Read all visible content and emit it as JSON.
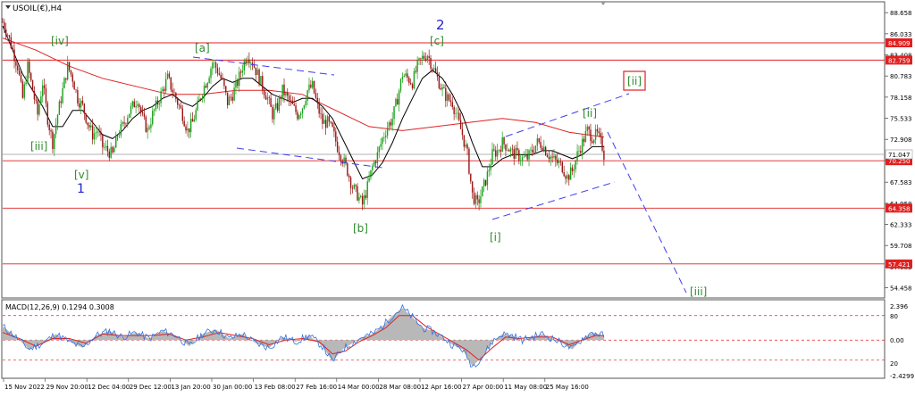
{
  "header": {
    "symbol_label": "USOIL(€),H4",
    "macd_label": "MACD(12,26,9) 0.1294 0.3008"
  },
  "colors": {
    "bull": "#1aa01a",
    "bear": "#9a1414",
    "ma_fast": "#000000",
    "ma_slow": "#e02020",
    "level_line": "#e02020",
    "channel": "#3d3df0",
    "wave_green": "#2e8b2e",
    "wave_blue": "#2222cc",
    "macd_signal": "#e02020",
    "macd_main": "#3070e0",
    "macd_hist": "#b8b8b8"
  },
  "price_axis": {
    "min": 53.3,
    "max": 89.9,
    "ticks": [
      "88.658",
      "86.033",
      "83.408",
      "80.783",
      "78.158",
      "75.533",
      "72.908",
      "70.283",
      "67.583",
      "64.958",
      "62.333",
      "59.708",
      "57.083",
      "54.458"
    ]
  },
  "levels": [
    {
      "value": 84.909,
      "label": "84.909"
    },
    {
      "value": 82.759,
      "label": "82.759"
    },
    {
      "value": 70.25,
      "label": "70.250"
    },
    {
      "value": 64.358,
      "label": "64.358"
    },
    {
      "value": 57.421,
      "label": "57.421"
    }
  ],
  "current_price": {
    "value": 71.047,
    "label": "71.047"
  },
  "time_axis": [
    "15 Nov 2022",
    "29 Nov 20:00",
    "12 Dec 04:00",
    "29 Dec 12:00",
    "13 Jan 20:00",
    "30 Jan 00:00",
    "13 Feb 08:00",
    "27 Feb 16:00",
    "14 Mar 00:00",
    "28 Mar 08:00",
    "12 Apr 16:00",
    "27 Apr 00:00",
    "11 May 08:00",
    "25 May 16:00"
  ],
  "wave_labels": [
    "[iv]",
    "[iii]",
    "[v]",
    "1",
    "[a]",
    "[b]",
    "2",
    "[c]",
    "[i]",
    "[ii]",
    "[iii]",
    "[ii]"
  ],
  "macd_axis": {
    "ticks": [
      "2.396",
      "80",
      "0.00",
      "20",
      "-2.4299"
    ]
  },
  "price_path": [
    [
      0,
      87.5
    ],
    [
      3,
      86
    ],
    [
      6,
      84
    ],
    [
      9,
      82
    ],
    [
      12,
      78
    ],
    [
      15,
      82
    ],
    [
      18,
      79
    ],
    [
      21,
      76
    ],
    [
      24,
      80
    ],
    [
      27,
      75.5
    ],
    [
      30,
      72.5
    ],
    [
      33,
      76
    ],
    [
      36,
      79
    ],
    [
      39,
      82
    ],
    [
      42,
      80.5
    ],
    [
      45,
      78
    ],
    [
      48,
      77
    ],
    [
      51,
      75
    ],
    [
      54,
      73.5
    ],
    [
      57,
      74
    ],
    [
      60,
      72
    ],
    [
      63,
      71.5
    ],
    [
      66,
      71
    ],
    [
      69,
      73.5
    ],
    [
      72,
      74.5
    ],
    [
      75,
      76
    ],
    [
      78,
      77
    ],
    [
      81,
      78
    ],
    [
      84,
      75.5
    ],
    [
      87,
      74
    ],
    [
      90,
      76
    ],
    [
      93,
      77.5
    ],
    [
      96,
      79
    ],
    [
      99,
      80.5
    ],
    [
      102,
      79
    ],
    [
      105,
      77.5
    ],
    [
      108,
      76
    ],
    [
      111,
      74
    ],
    [
      114,
      75
    ],
    [
      117,
      77
    ],
    [
      120,
      79
    ],
    [
      123,
      80.5
    ],
    [
      126,
      82.5
    ],
    [
      129,
      81.5
    ],
    [
      132,
      80
    ],
    [
      135,
      77.5
    ],
    [
      138,
      78.5
    ],
    [
      141,
      80
    ],
    [
      144,
      82
    ],
    [
      147,
      83.5
    ],
    [
      150,
      82.5
    ],
    [
      153,
      81
    ],
    [
      156,
      79.5
    ],
    [
      159,
      78
    ],
    [
      162,
      76
    ],
    [
      165,
      77
    ],
    [
      168,
      79
    ],
    [
      171,
      78
    ],
    [
      174,
      77
    ],
    [
      177,
      76
    ],
    [
      180,
      77
    ],
    [
      183,
      79
    ],
    [
      186,
      79.5
    ],
    [
      189,
      77
    ],
    [
      192,
      75
    ],
    [
      195,
      75
    ],
    [
      198,
      74
    ],
    [
      201,
      72
    ],
    [
      204,
      70.5
    ],
    [
      207,
      69
    ],
    [
      210,
      67
    ],
    [
      213,
      66
    ],
    [
      216,
      64.8
    ],
    [
      219,
      67
    ],
    [
      222,
      69.5
    ],
    [
      225,
      71
    ],
    [
      228,
      73
    ],
    [
      231,
      74.5
    ],
    [
      234,
      75.5
    ],
    [
      237,
      78
    ],
    [
      240,
      81
    ],
    [
      243,
      80.5
    ],
    [
      246,
      80
    ],
    [
      249,
      82
    ],
    [
      252,
      83
    ],
    [
      255,
      83.5
    ],
    [
      258,
      82
    ],
    [
      261,
      80.5
    ],
    [
      264,
      79
    ],
    [
      267,
      78
    ],
    [
      270,
      77.5
    ],
    [
      273,
      75.5
    ],
    [
      276,
      73.5
    ],
    [
      279,
      71
    ],
    [
      282,
      66
    ],
    [
      285,
      64.8
    ],
    [
      288,
      66.5
    ],
    [
      291,
      68.5
    ],
    [
      294,
      71
    ],
    [
      297,
      71.5
    ],
    [
      300,
      72.5
    ],
    [
      303,
      72
    ],
    [
      306,
      71.2
    ],
    [
      309,
      71
    ],
    [
      312,
      70.5
    ],
    [
      315,
      70.6
    ],
    [
      318,
      71.5
    ],
    [
      321,
      72.5
    ],
    [
      324,
      72.3
    ],
    [
      327,
      71.2
    ],
    [
      330,
      70.5
    ],
    [
      333,
      70
    ],
    [
      336,
      69.5
    ],
    [
      339,
      68.2
    ],
    [
      342,
      69
    ],
    [
      345,
      71
    ],
    [
      348,
      72.5
    ],
    [
      351,
      74
    ],
    [
      354,
      73.2
    ],
    [
      357,
      73.5
    ],
    [
      360,
      72
    ],
    [
      361,
      71
    ]
  ],
  "ma_fast_path": [
    [
      0,
      87
    ],
    [
      6,
      84
    ],
    [
      12,
      81
    ],
    [
      18,
      79
    ],
    [
      24,
      77
    ],
    [
      30,
      74.5
    ],
    [
      36,
      74.5
    ],
    [
      42,
      76.5
    ],
    [
      48,
      76.5
    ],
    [
      54,
      75
    ],
    [
      60,
      73.5
    ],
    [
      66,
      73
    ],
    [
      72,
      74
    ],
    [
      78,
      75.5
    ],
    [
      84,
      76.5
    ],
    [
      90,
      77
    ],
    [
      96,
      78
    ],
    [
      102,
      78.5
    ],
    [
      108,
      77.5
    ],
    [
      114,
      77
    ],
    [
      120,
      78
    ],
    [
      126,
      79.5
    ],
    [
      132,
      80.5
    ],
    [
      138,
      80
    ],
    [
      144,
      80.5
    ],
    [
      150,
      80.5
    ],
    [
      156,
      79.5
    ],
    [
      162,
      78.5
    ],
    [
      168,
      78
    ],
    [
      174,
      77.5
    ],
    [
      180,
      78
    ],
    [
      186,
      78
    ],
    [
      192,
      77
    ],
    [
      198,
      75.5
    ],
    [
      204,
      73
    ],
    [
      210,
      70.5
    ],
    [
      216,
      68
    ],
    [
      222,
      68.5
    ],
    [
      228,
      70
    ],
    [
      234,
      72.5
    ],
    [
      240,
      75.5
    ],
    [
      246,
      78
    ],
    [
      252,
      80.5
    ],
    [
      258,
      81.5
    ],
    [
      264,
      80.5
    ],
    [
      270,
      78.5
    ],
    [
      276,
      76
    ],
    [
      282,
      72.5
    ],
    [
      288,
      69.5
    ],
    [
      294,
      69.5
    ],
    [
      300,
      70.5
    ],
    [
      306,
      71
    ],
    [
      312,
      71
    ],
    [
      318,
      71
    ],
    [
      324,
      71.5
    ],
    [
      330,
      71.5
    ],
    [
      336,
      71
    ],
    [
      342,
      70.5
    ],
    [
      348,
      71
    ],
    [
      354,
      72
    ],
    [
      361,
      72
    ]
  ],
  "ma_slow_path": [
    [
      0,
      85.5
    ],
    [
      20,
      84
    ],
    [
      40,
      82
    ],
    [
      60,
      80.5
    ],
    [
      80,
      79.5
    ],
    [
      100,
      78.5
    ],
    [
      120,
      78.5
    ],
    [
      140,
      79
    ],
    [
      160,
      79
    ],
    [
      180,
      78.5
    ],
    [
      200,
      76.5
    ],
    [
      220,
      74.5
    ],
    [
      240,
      74
    ],
    [
      260,
      74.5
    ],
    [
      280,
      75
    ],
    [
      300,
      75.5
    ],
    [
      320,
      75
    ],
    [
      340,
      73.8
    ],
    [
      361,
      73.2
    ]
  ],
  "macd_path": [
    [
      0,
      0.9
    ],
    [
      8,
      0.2
    ],
    [
      16,
      -0.6
    ],
    [
      24,
      -0.2
    ],
    [
      32,
      0.4
    ],
    [
      40,
      -0.1
    ],
    [
      48,
      -0.5
    ],
    [
      56,
      0.3
    ],
    [
      64,
      0.6
    ],
    [
      72,
      0.2
    ],
    [
      80,
      0.5
    ],
    [
      88,
      0.1
    ],
    [
      96,
      0.6
    ],
    [
      104,
      0.3
    ],
    [
      112,
      -0.4
    ],
    [
      120,
      0.4
    ],
    [
      128,
      0.7
    ],
    [
      136,
      0.1
    ],
    [
      144,
      0.4
    ],
    [
      152,
      -0.2
    ],
    [
      160,
      -0.5
    ],
    [
      168,
      0.2
    ],
    [
      176,
      -0.1
    ],
    [
      184,
      0.3
    ],
    [
      192,
      -0.4
    ],
    [
      198,
      -1.4
    ],
    [
      204,
      -0.6
    ],
    [
      210,
      -0.2
    ],
    [
      216,
      0.2
    ],
    [
      222,
      0.4
    ],
    [
      228,
      0.9
    ],
    [
      234,
      1.6
    ],
    [
      240,
      2.1
    ],
    [
      246,
      1.5
    ],
    [
      252,
      0.8
    ],
    [
      258,
      0.6
    ],
    [
      264,
      0.2
    ],
    [
      270,
      -0.3
    ],
    [
      276,
      -0.6
    ],
    [
      282,
      -1.7
    ],
    [
      288,
      -1.1
    ],
    [
      294,
      -0.1
    ],
    [
      300,
      0.4
    ],
    [
      306,
      0.3
    ],
    [
      312,
      0.0
    ],
    [
      318,
      0.2
    ],
    [
      324,
      0.4
    ],
    [
      330,
      0.1
    ],
    [
      336,
      -0.2
    ],
    [
      342,
      -0.6
    ],
    [
      348,
      0.1
    ],
    [
      354,
      0.5
    ],
    [
      361,
      0.3
    ]
  ],
  "macd_signal_path": [
    [
      0,
      0.5
    ],
    [
      10,
      0.1
    ],
    [
      20,
      -0.4
    ],
    [
      30,
      0.1
    ],
    [
      40,
      0.1
    ],
    [
      50,
      -0.2
    ],
    [
      60,
      0.4
    ],
    [
      70,
      0.3
    ],
    [
      80,
      0.3
    ],
    [
      90,
      0.3
    ],
    [
      100,
      0.4
    ],
    [
      110,
      0.0
    ],
    [
      120,
      0.2
    ],
    [
      130,
      0.5
    ],
    [
      140,
      0.3
    ],
    [
      150,
      0.1
    ],
    [
      160,
      -0.3
    ],
    [
      170,
      0.0
    ],
    [
      180,
      0.1
    ],
    [
      190,
      -0.1
    ],
    [
      198,
      -0.9
    ],
    [
      206,
      -0.7
    ],
    [
      214,
      -0.1
    ],
    [
      222,
      0.3
    ],
    [
      230,
      0.8
    ],
    [
      238,
      1.6
    ],
    [
      246,
      1.6
    ],
    [
      254,
      0.9
    ],
    [
      262,
      0.4
    ],
    [
      270,
      -0.1
    ],
    [
      278,
      -0.6
    ],
    [
      286,
      -1.3
    ],
    [
      294,
      -0.5
    ],
    [
      302,
      0.2
    ],
    [
      310,
      0.1
    ],
    [
      320,
      0.2
    ],
    [
      330,
      0.2
    ],
    [
      340,
      -0.3
    ],
    [
      348,
      0.0
    ],
    [
      356,
      0.3
    ],
    [
      361,
      0.3
    ]
  ]
}
